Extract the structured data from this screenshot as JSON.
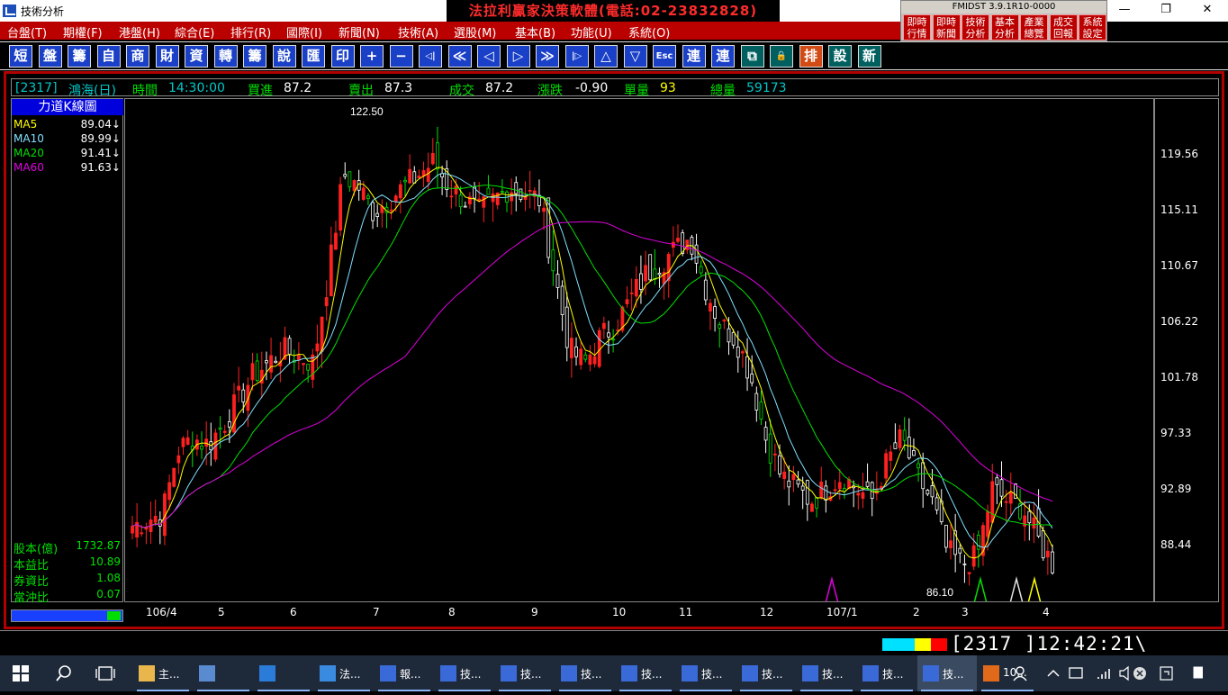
{
  "window": {
    "title": "技術分析",
    "banner": "法拉利贏家決策軟體(電話:02-23832828)",
    "min": "—",
    "max": "❐",
    "close": "✕"
  },
  "menu": [
    "台盤(T)",
    "期權(F)",
    "港盤(H)",
    "綜合(E)",
    "排行(R)",
    "國際(I)",
    "新聞(N)",
    "技術(A)",
    "選股(M)",
    "基本(B)",
    "功能(U)",
    "系統(O)"
  ],
  "fmidst": {
    "title": "FMIDST 3.9.1R10-0000",
    "buttons": [
      [
        "即時",
        "行情"
      ],
      [
        "即時",
        "新聞"
      ],
      [
        "技術",
        "分析"
      ],
      [
        "基本",
        "分析"
      ],
      [
        "產業",
        "總覽"
      ],
      [
        "成交",
        "回報"
      ],
      [
        "系統",
        "設定"
      ]
    ]
  },
  "toolbar": [
    "短",
    "盤",
    "籌",
    "自",
    "商",
    "財",
    "資",
    "轉",
    "籌",
    "說",
    "匯",
    "印",
    "+",
    "−",
    "◁|",
    "≪",
    "◁",
    "▷",
    "≫",
    "|▷",
    "△",
    "▽",
    "Esc",
    "連",
    "連",
    "⧉",
    "🔒",
    "排",
    "設",
    "新"
  ],
  "quote": {
    "code": "[2317]",
    "name": "鴻海(日)",
    "time_label": "時間",
    "time": "14:30:00",
    "bid_label": "買進",
    "bid": "87.2",
    "ask_label": "賣出",
    "ask": "87.3",
    "last_label": "成交",
    "last": "87.2",
    "chg_label": "漲跌",
    "chg": "-0.90",
    "vol_label": "單量",
    "vol": "93",
    "total_label": "總量",
    "total": "59173"
  },
  "left_panel": {
    "title": "力道K線圖",
    "ma": [
      {
        "label": "MA5",
        "value": "89.04↓",
        "color": "#ffff00"
      },
      {
        "label": "MA10",
        "value": "89.99↓",
        "color": "#80e0ff"
      },
      {
        "label": "MA20",
        "value": "91.41↓",
        "color": "#00e000"
      },
      {
        "label": "MA60",
        "value": "91.63↓",
        "color": "#e000e0"
      }
    ],
    "stats": [
      {
        "label": "股本(億)",
        "value": "1732.87"
      },
      {
        "label": "本益比",
        "value": "10.89"
      },
      {
        "label": "券資比",
        "value": "1.08"
      },
      {
        "label": "當沖比",
        "value": "0.07"
      }
    ]
  },
  "chart_data": {
    "type": "candlestick",
    "ylim": [
      84.0,
      124.0
    ],
    "yticks": [
      "119.56",
      "115.11",
      "110.67",
      "106.22",
      "101.78",
      "97.33",
      "92.89",
      "88.44"
    ],
    "xticks": [
      "106/4",
      "5",
      "6",
      "7",
      "8",
      "9",
      "10",
      "11",
      "12",
      "107/1",
      "2",
      "3",
      "4"
    ],
    "high_label": "122.50",
    "low_label": "86.10",
    "close_path": [
      90,
      90.5,
      91,
      96,
      97,
      96.5,
      98,
      100,
      102,
      103,
      104,
      103.5,
      103,
      110,
      118,
      117,
      115,
      116,
      117,
      118,
      119,
      117,
      116,
      115,
      116,
      117,
      116.5,
      116,
      110,
      104,
      103,
      105,
      106,
      108,
      110,
      111,
      112,
      113,
      109,
      106,
      105,
      102,
      97,
      94,
      93,
      92,
      93,
      94,
      93,
      92,
      95,
      97,
      94,
      92,
      88,
      87,
      87.5,
      93,
      92,
      91.5,
      89,
      87
    ]
  },
  "status": {
    "text": "[2317  ]12:42:21\\"
  },
  "taskbar": [
    {
      "label": "主...",
      "color": "#e8b64b"
    },
    {
      "label": "",
      "color": "#5a8ad0"
    },
    {
      "label": "",
      "color": "#2a7cd8"
    },
    {
      "label": "法...",
      "color": "#3a8ae0"
    },
    {
      "label": "報...",
      "color": "#3a6ad8"
    },
    {
      "label": "技...",
      "color": "#3a6ad8"
    },
    {
      "label": "技...",
      "color": "#3a6ad8"
    },
    {
      "label": "技...",
      "color": "#3a6ad8"
    },
    {
      "label": "技...",
      "color": "#3a6ad8"
    },
    {
      "label": "技...",
      "color": "#3a6ad8"
    },
    {
      "label": "技...",
      "color": "#3a6ad8"
    },
    {
      "label": "技...",
      "color": "#3a6ad8"
    },
    {
      "label": "技...",
      "color": "#3a6ad8"
    },
    {
      "label": "技...",
      "color": "#3a6ad8"
    },
    {
      "label": "10...",
      "color": "#e06a1a"
    }
  ]
}
